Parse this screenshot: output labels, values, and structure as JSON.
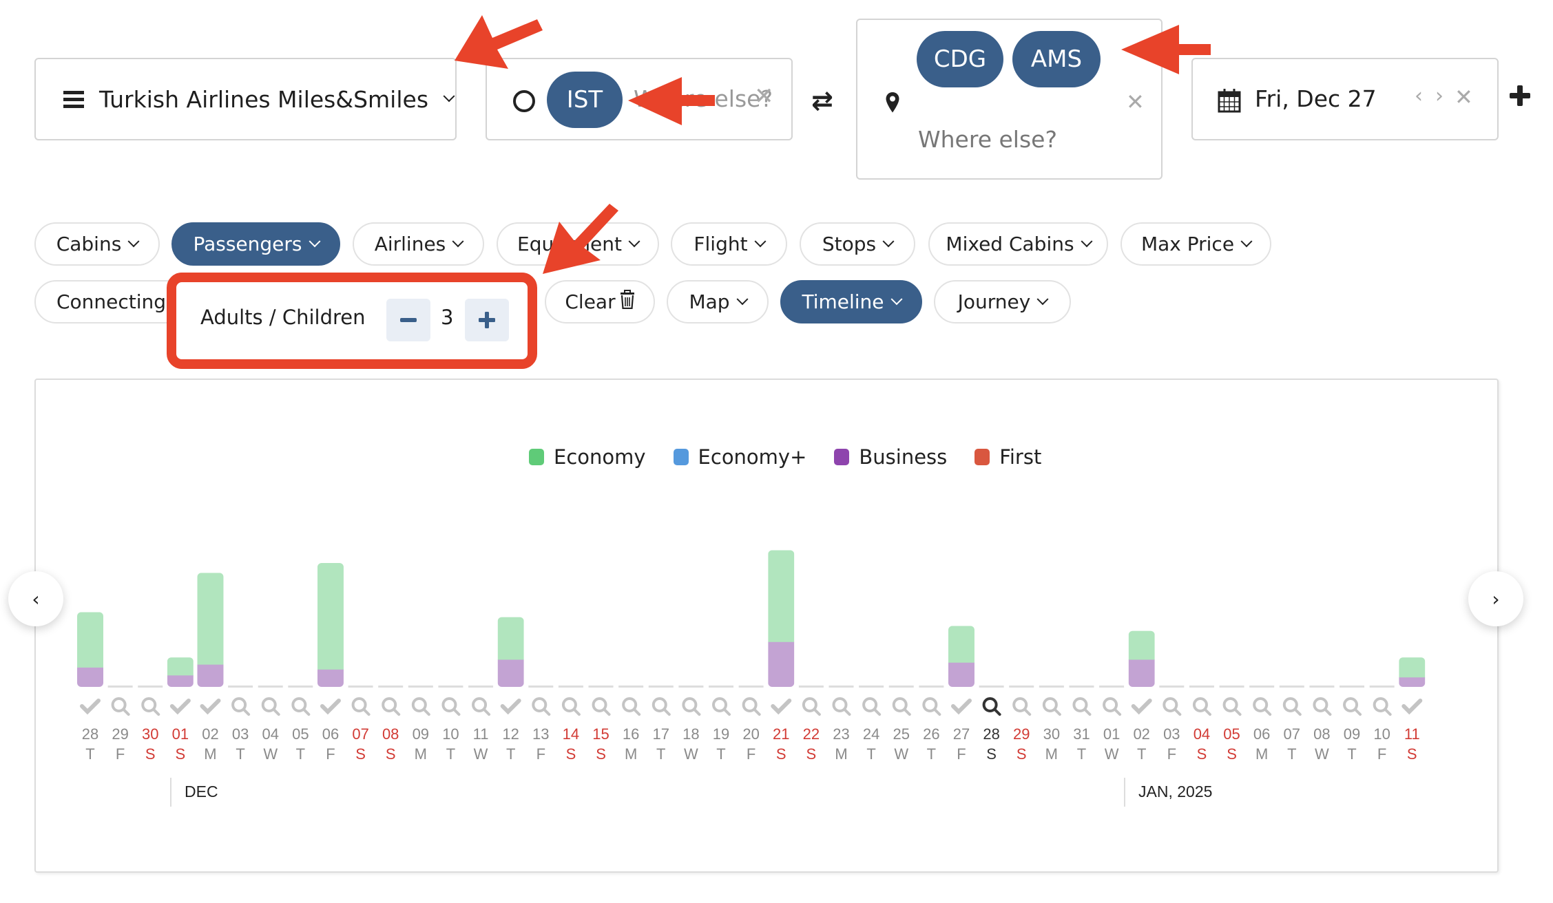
{
  "program_selector": {
    "icon": "hamburger-menu-icon",
    "label": "Turkish Airlines Miles&Smiles"
  },
  "origin": {
    "icon": "circle-origin-icon",
    "airports": [
      "IST"
    ],
    "placeholder": "Where else?",
    "clear_icon": "close-icon"
  },
  "swap_icon": "swap-arrows-icon",
  "destination": {
    "icon": "map-pin-icon",
    "airports": [
      "CDG",
      "AMS"
    ],
    "placeholder": "Where else?",
    "clear_icon": "close-icon"
  },
  "date": {
    "icon": "calendar-icon",
    "value": "Fri, Dec 27",
    "prev_icon": "chevron-left-icon",
    "next_icon": "chevron-right-icon",
    "clear_icon": "close-icon"
  },
  "add_segment_icon": "plus-icon",
  "filters_row1": [
    {
      "label": "Cabins",
      "active": false
    },
    {
      "label": "Passengers",
      "active": true
    },
    {
      "label": "Airlines",
      "active": false
    },
    {
      "label": "Equipment",
      "active": false
    },
    {
      "label": "Flight",
      "active": false
    },
    {
      "label": "Stops",
      "active": false
    },
    {
      "label": "Mixed Cabins",
      "active": false
    },
    {
      "label": "Max Price",
      "active": false
    }
  ],
  "filters_row2": [
    {
      "label": "Connecting Airports",
      "active": false
    },
    {
      "label": "Clear",
      "active": false,
      "icon": "trash-icon"
    },
    {
      "label": "Map",
      "active": false
    },
    {
      "label": "Timeline",
      "active": true
    },
    {
      "label": "Journey",
      "active": false
    }
  ],
  "passengers_popup": {
    "label": "Adults / Children",
    "value": "3",
    "decrement_icon": "minus-icon",
    "increment_icon": "plus-icon"
  },
  "colors": {
    "accent": "#3a5f8a",
    "annotation": "#e8432a",
    "weekend": "#d23b35"
  },
  "timeline": {
    "prev_icon": "chevron-left-icon",
    "next_icon": "chevron-right-icon",
    "months": [
      {
        "label": "DEC",
        "start_index": 3
      },
      {
        "label": "JAN, 2025",
        "start_index": 34
      }
    ]
  },
  "chart_data": {
    "type": "bar",
    "stacked": true,
    "title": "",
    "xlabel": "",
    "ylabel": "",
    "grid": false,
    "legend_position": "top-center",
    "legend": [
      {
        "name": "Economy",
        "color": "#5fcb78"
      },
      {
        "name": "Economy+",
        "color": "#5599dd"
      },
      {
        "name": "Business",
        "color": "#8e44ad"
      },
      {
        "name": "First",
        "color": "#d9573f"
      }
    ],
    "value_unit": "relative availability (no axis shown)",
    "ylim": [
      0,
      140
    ],
    "selected_index": 30,
    "categories": [
      "28",
      "29",
      "30",
      "01",
      "02",
      "03",
      "04",
      "05",
      "06",
      "07",
      "08",
      "09",
      "10",
      "11",
      "12",
      "13",
      "14",
      "15",
      "16",
      "17",
      "18",
      "19",
      "20",
      "21",
      "22",
      "23",
      "24",
      "25",
      "26",
      "27",
      "28",
      "29",
      "30",
      "31",
      "01",
      "02",
      "03",
      "04",
      "05",
      "06",
      "07",
      "08",
      "09",
      "10",
      "11"
    ],
    "weekdays": [
      "T",
      "F",
      "S",
      "S",
      "M",
      "T",
      "W",
      "T",
      "F",
      "S",
      "S",
      "M",
      "T",
      "W",
      "T",
      "F",
      "S",
      "S",
      "M",
      "T",
      "W",
      "T",
      "F",
      "S",
      "S",
      "M",
      "T",
      "W",
      "T",
      "F",
      "S",
      "S",
      "M",
      "T",
      "W",
      "T",
      "F",
      "S",
      "S",
      "M",
      "T",
      "W",
      "T",
      "F",
      "S"
    ],
    "weekend": [
      false,
      false,
      true,
      true,
      false,
      false,
      false,
      false,
      false,
      true,
      true,
      false,
      false,
      false,
      false,
      false,
      true,
      true,
      false,
      false,
      false,
      false,
      false,
      true,
      true,
      false,
      false,
      false,
      false,
      false,
      true,
      true,
      false,
      false,
      false,
      false,
      false,
      true,
      true,
      false,
      false,
      false,
      false,
      false,
      true
    ],
    "status": [
      "check",
      "search",
      "search",
      "check",
      "check",
      "search",
      "search",
      "search",
      "check",
      "search",
      "search",
      "search",
      "search",
      "search",
      "check",
      "search",
      "search",
      "search",
      "search",
      "search",
      "search",
      "search",
      "search",
      "check",
      "search",
      "search",
      "search",
      "search",
      "search",
      "check",
      "search",
      "search",
      "search",
      "search",
      "search",
      "check",
      "search",
      "search",
      "search",
      "search",
      "search",
      "search",
      "search",
      "search",
      "check"
    ],
    "series": [
      {
        "name": "Economy",
        "values": [
          56,
          0,
          0,
          18,
          93,
          0,
          0,
          0,
          108,
          0,
          0,
          0,
          0,
          0,
          43,
          0,
          0,
          0,
          0,
          0,
          0,
          0,
          0,
          93,
          0,
          0,
          0,
          0,
          0,
          37,
          0,
          0,
          0,
          0,
          0,
          29,
          0,
          0,
          0,
          0,
          0,
          0,
          0,
          0,
          20
        ]
      },
      {
        "name": "Economy+",
        "values": [
          0,
          0,
          0,
          0,
          0,
          0,
          0,
          0,
          0,
          0,
          0,
          0,
          0,
          0,
          0,
          0,
          0,
          0,
          0,
          0,
          0,
          0,
          0,
          0,
          0,
          0,
          0,
          0,
          0,
          0,
          0,
          0,
          0,
          0,
          0,
          0,
          0,
          0,
          0,
          0,
          0,
          0,
          0,
          0,
          0
        ]
      },
      {
        "name": "Business",
        "values": [
          20,
          0,
          0,
          12,
          23,
          0,
          0,
          0,
          18,
          0,
          0,
          0,
          0,
          0,
          28,
          0,
          0,
          0,
          0,
          0,
          0,
          0,
          0,
          46,
          0,
          0,
          0,
          0,
          0,
          25,
          0,
          0,
          0,
          0,
          0,
          28,
          0,
          0,
          0,
          0,
          0,
          0,
          0,
          0,
          10
        ]
      },
      {
        "name": "First",
        "values": [
          0,
          0,
          0,
          0,
          0,
          0,
          0,
          0,
          0,
          0,
          0,
          0,
          0,
          0,
          0,
          0,
          0,
          0,
          0,
          0,
          0,
          0,
          0,
          0,
          0,
          0,
          0,
          0,
          0,
          0,
          0,
          0,
          0,
          0,
          0,
          0,
          0,
          0,
          0,
          0,
          0,
          0,
          0,
          0,
          0
        ]
      }
    ]
  }
}
